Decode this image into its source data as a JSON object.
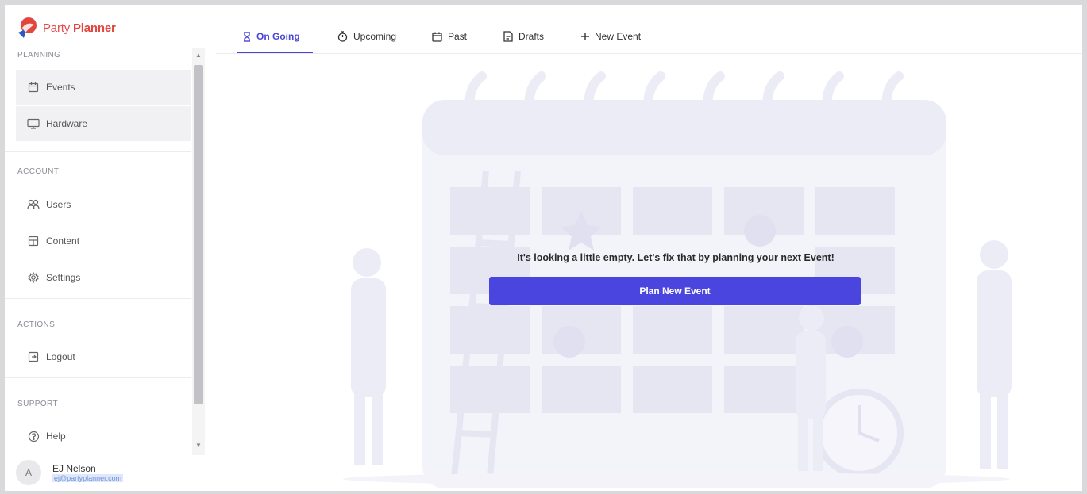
{
  "app": {
    "logo_part1": "Party",
    "logo_part2": "Planner"
  },
  "sidebar": {
    "sections": [
      {
        "label": "PLANNING"
      },
      {
        "label": "ACCOUNT"
      },
      {
        "label": "ACTIONS"
      },
      {
        "label": "SUPPORT"
      }
    ],
    "items": [
      {
        "label": "Events",
        "icon": "calendar-icon",
        "active": true
      },
      {
        "label": "Hardware",
        "icon": "monitor-icon",
        "active": true
      },
      {
        "label": "Users",
        "icon": "users-icon"
      },
      {
        "label": "Content",
        "icon": "content-icon"
      },
      {
        "label": "Settings",
        "icon": "gear-icon"
      },
      {
        "label": "Logout",
        "icon": "logout-icon"
      },
      {
        "label": "Help",
        "icon": "help-icon"
      }
    ],
    "user": {
      "initial": "A",
      "name": "EJ Nelson",
      "email": "ej@partyplanner.com"
    }
  },
  "tabs": [
    {
      "label": "On Going",
      "icon": "hourglass-icon",
      "active": true
    },
    {
      "label": "Upcoming",
      "icon": "stopwatch-icon"
    },
    {
      "label": "Past",
      "icon": "calendar-icon"
    },
    {
      "label": "Drafts",
      "icon": "draft-icon"
    },
    {
      "label": "New Event",
      "icon": "plus-icon"
    }
  ],
  "empty_state": {
    "message": "It's looking a little empty. Let's fix that by planning your next Event!",
    "button_label": "Plan New Event"
  },
  "colors": {
    "accent": "#4b45e0",
    "brand": "#e2463f",
    "illustration": "#efeff8"
  }
}
